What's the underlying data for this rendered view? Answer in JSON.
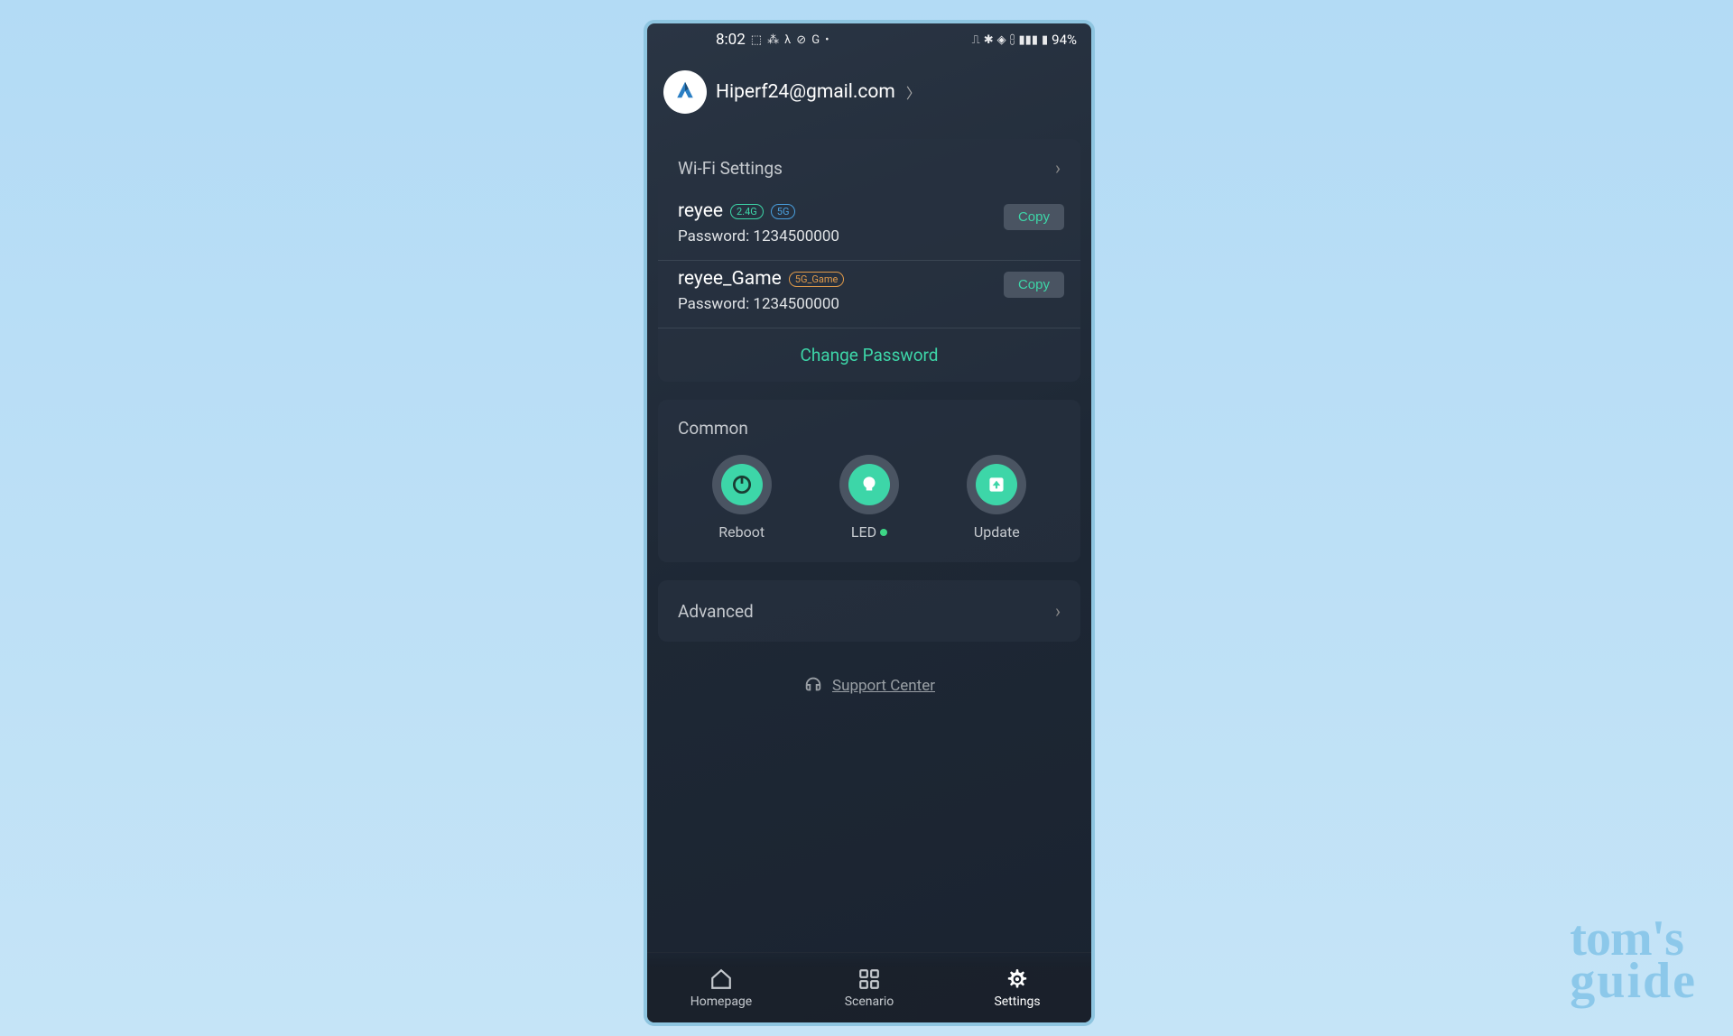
{
  "status": {
    "time": "8:02",
    "battery": "94%"
  },
  "account": {
    "email": "Hiperf24@gmail.com"
  },
  "wifi": {
    "title": "Wi-Fi Settings",
    "networks": [
      {
        "ssid": "reyee",
        "badges": [
          "2.4G",
          "5G"
        ],
        "password_label": "Password: 1234500000",
        "copy": "Copy"
      },
      {
        "ssid": "reyee_Game",
        "badges": [
          "5G_Game"
        ],
        "password_label": "Password: 1234500000",
        "copy": "Copy"
      }
    ],
    "change_password": "Change Password"
  },
  "common": {
    "title": "Common",
    "items": {
      "reboot": "Reboot",
      "led": "LED",
      "update": "Update"
    }
  },
  "advanced": {
    "title": "Advanced"
  },
  "support": {
    "label": "Support Center"
  },
  "nav": {
    "homepage": "Homepage",
    "scenario": "Scenario",
    "settings": "Settings"
  },
  "watermark": {
    "line1": "tom's",
    "line2": "guide"
  }
}
